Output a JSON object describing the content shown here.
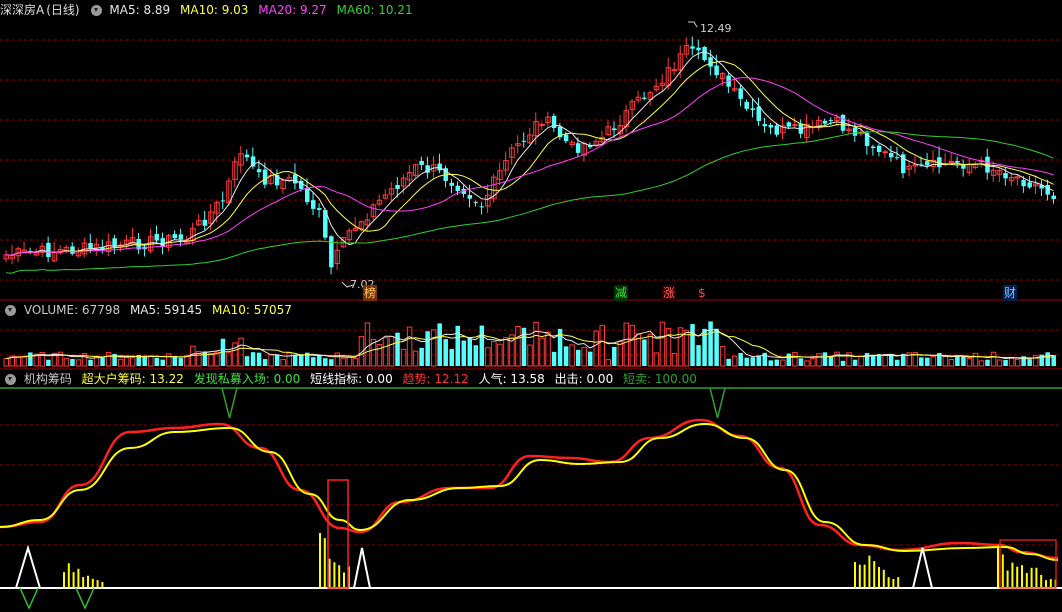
{
  "colors": {
    "up": "#ff3b3b",
    "down": "#54ffff",
    "ma5": "#e8e8e8",
    "ma10": "#ffff40",
    "ma20": "#ff40ff",
    "ma60": "#30d030",
    "grid": "#8b0000",
    "white": "#ffffff",
    "yellow": "#ffff00",
    "red": "#ff2020",
    "green": "#30c030",
    "label": "#c8c8c8"
  },
  "title": {
    "name": "深深房A",
    "period": "(日线)"
  },
  "ma_header": [
    {
      "label": "MA5: 8.89",
      "color": "#e8e8e8"
    },
    {
      "label": "MA10: 9.03",
      "color": "#ffff40"
    },
    {
      "label": "MA20: 9.27",
      "color": "#ff40ff"
    },
    {
      "label": "MA60: 10.21",
      "color": "#30d030"
    }
  ],
  "price_annotations": {
    "high": "12.49",
    "low": "7.02"
  },
  "event_markers": [
    {
      "text": "榜",
      "color": "#ffcc66",
      "bg": "#7a3000"
    },
    {
      "text": "减",
      "color": "#40e040",
      "bg": "#003300"
    },
    {
      "text": "涨",
      "color": "#ff6060",
      "bg": "#330000"
    },
    {
      "text": "$",
      "color": "#ff4040",
      "bg": "#000000"
    },
    {
      "text": "财",
      "color": "#80c0ff",
      "bg": "#002050"
    }
  ],
  "volume_header": [
    {
      "label": "VOLUME: 67798",
      "color": "#c8c8c8"
    },
    {
      "label": "MA5: 59145",
      "color": "#e8e8e8"
    },
    {
      "label": "MA10: 57057",
      "color": "#ffff40"
    }
  ],
  "indicator_header": [
    {
      "label": "机构筹码",
      "color": "#c8c8c8"
    },
    {
      "label": "超大户筹码: 13.22",
      "color": "#ffff40"
    },
    {
      "label": "发现私募入场: 0.00",
      "color": "#40e040"
    },
    {
      "label": "短线指标: 0.00",
      "color": "#ffffff"
    },
    {
      "label": "趋势: 12.12",
      "color": "#ff3030"
    },
    {
      "label": "人气: 13.58",
      "color": "#ffffff"
    },
    {
      "label": "出击: 0.00",
      "color": "#ffffff"
    },
    {
      "label": "短卖: 100.00",
      "color": "#30a030"
    }
  ]
}
